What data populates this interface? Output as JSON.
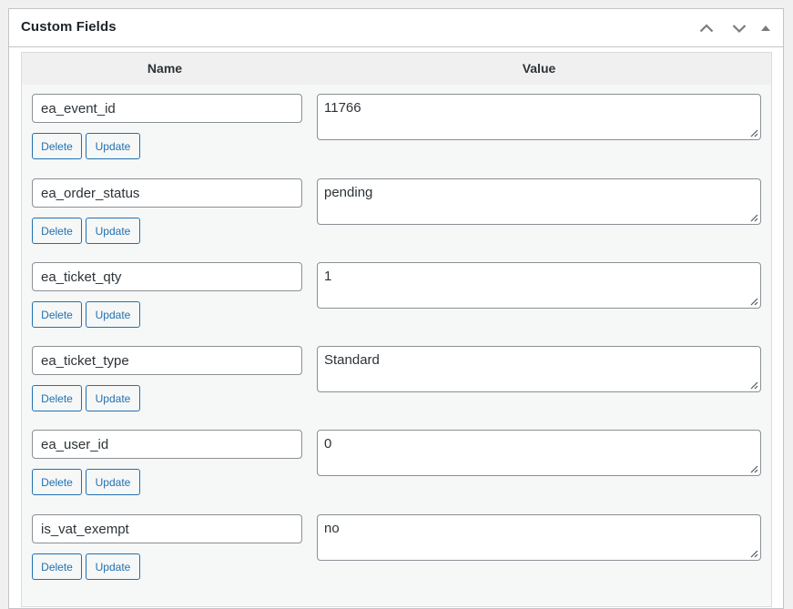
{
  "panel": {
    "title": "Custom Fields",
    "actions": [
      {
        "name": "move-up-button",
        "icon": "chevron-up-icon"
      },
      {
        "name": "move-down-button",
        "icon": "chevron-down-icon"
      },
      {
        "name": "toggle-panel-button",
        "icon": "triangle-up-icon"
      }
    ]
  },
  "table": {
    "headers": {
      "name": "Name",
      "value": "Value"
    },
    "delete_label": "Delete",
    "update_label": "Update",
    "rows": [
      {
        "key": "ea_event_id",
        "value": "11766"
      },
      {
        "key": "ea_order_status",
        "value": "pending"
      },
      {
        "key": "ea_ticket_qty",
        "value": "1"
      },
      {
        "key": "ea_ticket_type",
        "value": "Standard"
      },
      {
        "key": "ea_user_id",
        "value": "0"
      },
      {
        "key": "is_vat_exempt",
        "value": "no"
      }
    ]
  },
  "colors": {
    "accent": "#2271b1",
    "border": "#8c8f94",
    "panel_bg": "#f6f7f7"
  }
}
